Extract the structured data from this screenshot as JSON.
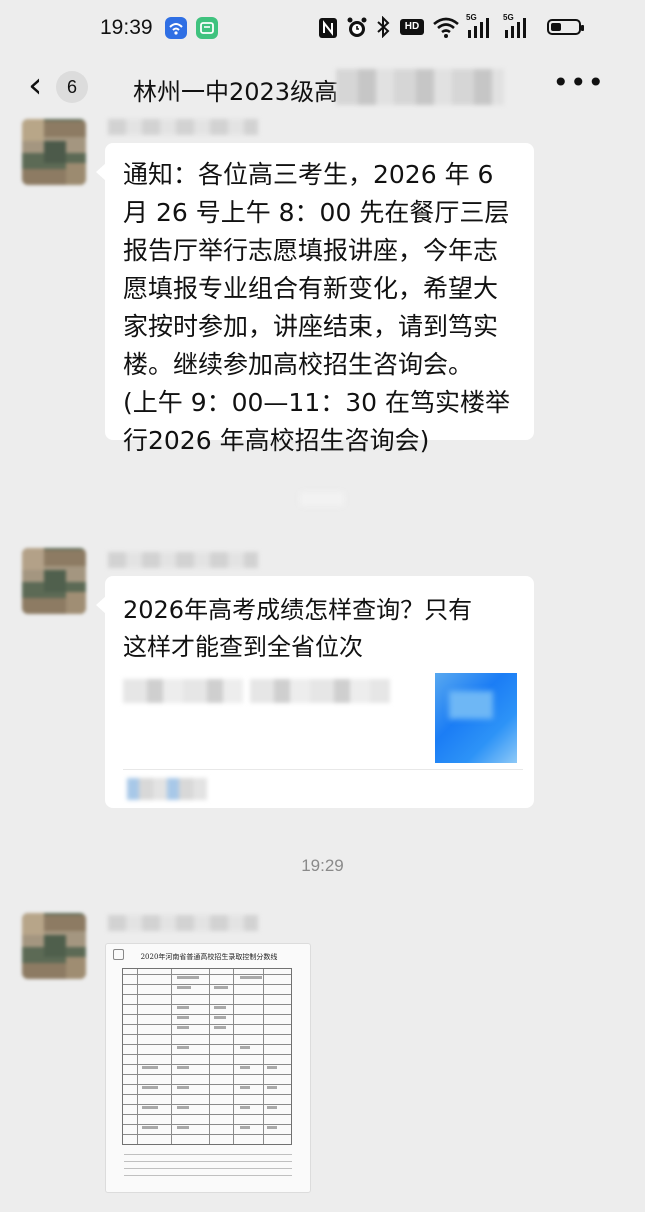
{
  "status_bar": {
    "time": "19:39",
    "icons": [
      "wifi-app-icon",
      "green-app-icon",
      "nfc-icon",
      "alarm-icon",
      "bluetooth-icon",
      "hd-icon",
      "wifi-icon",
      "5g-signal-icon",
      "5g-signal-icon",
      "battery-icon"
    ],
    "hd_label": "HD",
    "net_label_1": "5G",
    "net_label_2": "5G",
    "battery_level": 0.38
  },
  "header": {
    "back_icon": "chevron-left-icon",
    "unread_count": "6",
    "title": "林州一中2023级高",
    "more_icon": "more-horizontal-icon"
  },
  "messages": [
    {
      "type": "text",
      "text": "通知：各位高三考生，2026 年 6\n月 26 号上午 8：00 先在餐厅三层\n报告厅举行志愿填报讲座，今年志\n愿填报专业组合有新变化，希望大\n家按时参加，讲座结束，请到笃实\n楼。继续参加高校招生咨询会。\n(上午 9：00—11：30 在笃实楼举\n行2026 年高校招生咨询会)"
    },
    {
      "type": "link",
      "title": "2026年高考成绩怎样查询？只有\n这样才能查到全省位次"
    },
    {
      "type": "image",
      "doc_title": "2020年河南省普通高校招生录取控制分数线"
    }
  ],
  "timestamp": "19:29",
  "colors": {
    "background": "#ededed",
    "bubble": "#ffffff",
    "timestamp": "#8a8a8a",
    "link_thumb": "#1b7df5"
  }
}
